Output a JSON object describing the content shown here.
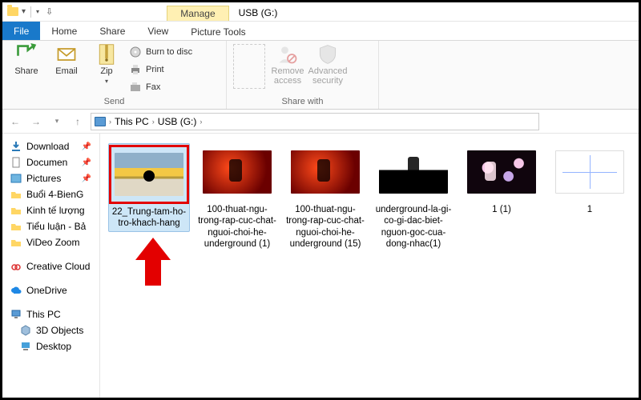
{
  "titlebar": {
    "context_tab": "Manage",
    "window_title": "USB (G:)"
  },
  "tabs": {
    "file": "File",
    "home": "Home",
    "share": "Share",
    "view": "View",
    "picture_tools": "Picture Tools"
  },
  "ribbon": {
    "send": {
      "share": "Share",
      "email": "Email",
      "zip": "Zip",
      "burn": "Burn to disc",
      "print": "Print",
      "fax": "Fax",
      "group_label": "Send"
    },
    "sharewith": {
      "remove": "Remove access",
      "advanced": "Advanced security",
      "group_label": "Share with"
    }
  },
  "breadcrumb": {
    "root": "This PC",
    "loc": "USB (G:)"
  },
  "sidebar": {
    "items": [
      {
        "label": "Download",
        "icon": "download"
      },
      {
        "label": "Documen",
        "icon": "document"
      },
      {
        "label": "Pictures",
        "icon": "pictures"
      },
      {
        "label": "Buổi 4-BienG",
        "icon": "folder"
      },
      {
        "label": "Kinh tế lượng",
        "icon": "folder"
      },
      {
        "label": "Tiểu luận - Bả",
        "icon": "folder"
      },
      {
        "label": "ViDeo Zoom",
        "icon": "folder"
      }
    ],
    "creative_cloud": "Creative Cloud",
    "onedrive": "OneDrive",
    "this_pc": "This PC",
    "objects3d": "3D Objects",
    "desktop": "Desktop"
  },
  "files": [
    {
      "name": "22_Trung-tam-ho-tro-khach-hang",
      "thumb": "img1",
      "selected": true,
      "highlighted": true
    },
    {
      "name": "100-thuat-ngu-trong-rap-cuc-chat-nguoi-choi-he-underground (1)",
      "thumb": "img-stage-red"
    },
    {
      "name": "100-thuat-ngu-trong-rap-cuc-chat-nguoi-choi-he-underground (15)",
      "thumb": "img-stage-red"
    },
    {
      "name": "underground-la-gi-co-gi-dac-biet-nguon-goc-cua-dong-nhac(1)",
      "thumb": "img-stage-bw"
    },
    {
      "name": "1 (1)",
      "thumb": "img-bokeh"
    },
    {
      "name": "1",
      "thumb": "img-graph"
    }
  ]
}
